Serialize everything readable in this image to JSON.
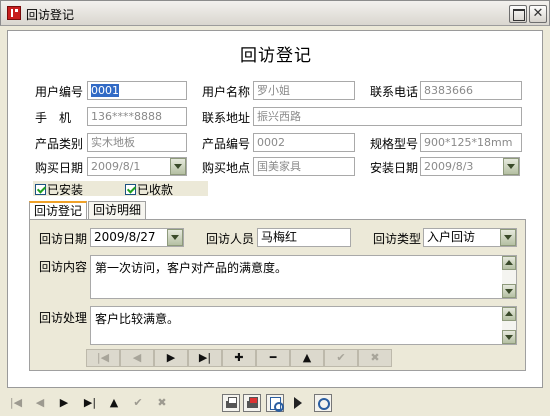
{
  "window": {
    "title": "回访登记",
    "close_glyph": "✕"
  },
  "form": {
    "heading": "回访登记",
    "fields": {
      "user_no": {
        "label": "用户编号",
        "value": "0001"
      },
      "user_name": {
        "label": "用户名称",
        "value": "罗小姐"
      },
      "phone": {
        "label": "联系电话",
        "value": "8383666"
      },
      "mobile": {
        "label": "手　机",
        "value": "136****8888"
      },
      "address": {
        "label": "联系地址",
        "value": "振兴西路"
      },
      "category": {
        "label": "产品类别",
        "value": "实木地板"
      },
      "product_no": {
        "label": "产品编号",
        "value": "0002"
      },
      "spec": {
        "label": "规格型号",
        "value": "900*125*18mm"
      },
      "buy_date": {
        "label": "购买日期",
        "value": "2009/8/1"
      },
      "buy_place": {
        "label": "购买地点",
        "value": "国美家具"
      },
      "install_date": {
        "label": "安装日期",
        "value": "2009/8/3"
      }
    },
    "checks": {
      "installed": "已安装",
      "paid": "已收款"
    }
  },
  "tabs": [
    {
      "label": "回访登记",
      "active": true
    },
    {
      "label": "回访明细",
      "active": false
    }
  ],
  "visit": {
    "date": {
      "label": "回访日期",
      "value": "2009/8/27"
    },
    "staff": {
      "label": "回访人员",
      "value": "马梅红"
    },
    "type": {
      "label": "回访类型",
      "value": "入户回访"
    },
    "content": {
      "label": "回访内容",
      "value": "第一次访问，客户对产品的满意度。"
    },
    "handle": {
      "label": "回访处理",
      "value": "客户比较满意。"
    }
  },
  "navigator": {
    "first": "|◀",
    "prior": "◀",
    "next": "▶",
    "last": "▶|",
    "insert": "✚",
    "delete": "━",
    "edit": "▲",
    "post": "✔",
    "cancel": "✖"
  },
  "bottom_nav": {
    "first": "|◀",
    "prior": "◀",
    "next": "▶",
    "last": "▶|",
    "edit": "▲",
    "post": "✔",
    "cancel": "✖"
  },
  "toolbar_icons": [
    "printer-icon",
    "printer-setup-icon",
    "print-preview-icon",
    "play-icon",
    "zoom-icon"
  ]
}
